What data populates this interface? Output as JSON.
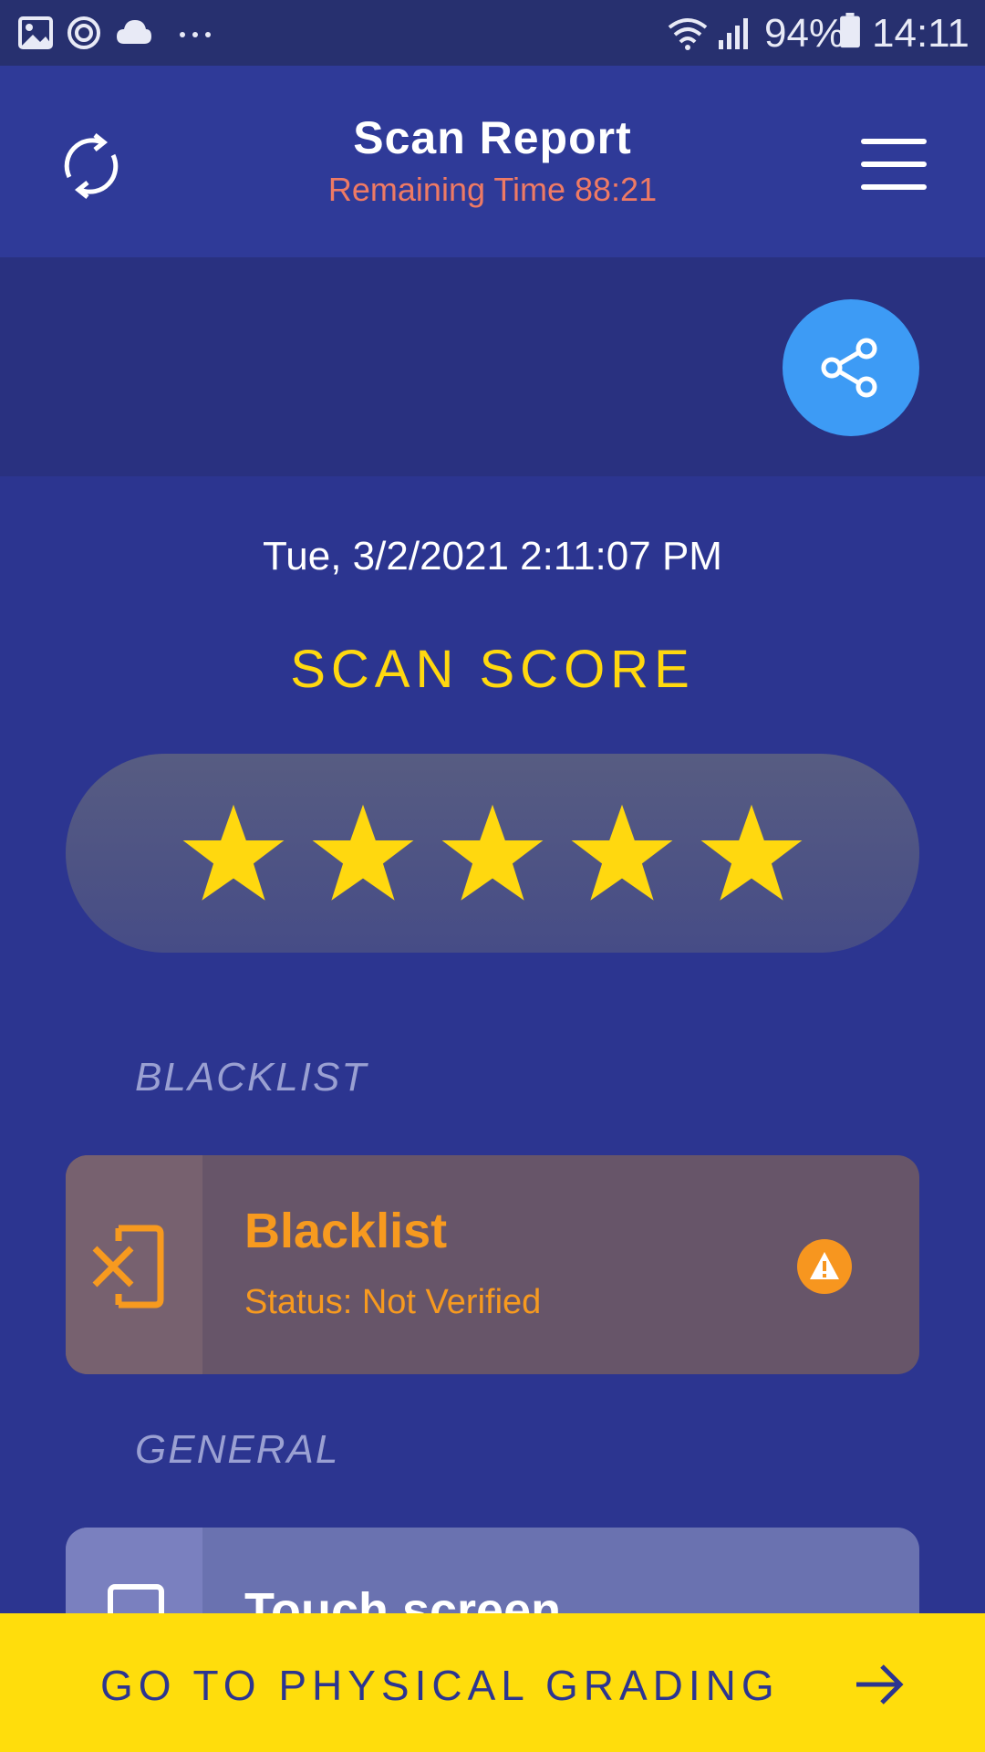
{
  "status_bar": {
    "battery": "94%",
    "time": "14:11",
    "icons": [
      "gallery-icon",
      "sync-icon",
      "cloud-icon",
      "more-icon",
      "wifi-icon",
      "signal-icon",
      "battery-icon"
    ]
  },
  "header": {
    "title": "Scan Report",
    "remaining_time": "Remaining Time 88:21",
    "refresh_icon": "refresh-icon",
    "menu_icon": "hamburger-menu-icon"
  },
  "share": {
    "icon": "share-icon",
    "color": "#3d9bf5"
  },
  "report": {
    "datetime": "Tue, 3/2/2021 2:11:07 PM",
    "score_title": "SCAN SCORE",
    "stars_filled": 5,
    "stars_total": 5,
    "star_color": "#ffd80f"
  },
  "sections": {
    "blacklist_label": "BLACKLIST",
    "general_label": "GENERAL"
  },
  "blacklist_card": {
    "name": "Blacklist",
    "status": "Status: Not Verified",
    "icon": "device-blocked-icon",
    "status_icon": "warning-icon",
    "accent": "#f79a1f"
  },
  "general_card": {
    "name": "Touch screen",
    "icon": "phone-icon",
    "status_icon": "check-icon"
  },
  "bottom_action": {
    "label": "GO TO PHYSICAL GRADING",
    "icon": "arrow-right-icon",
    "background": "#ffdd0c"
  }
}
